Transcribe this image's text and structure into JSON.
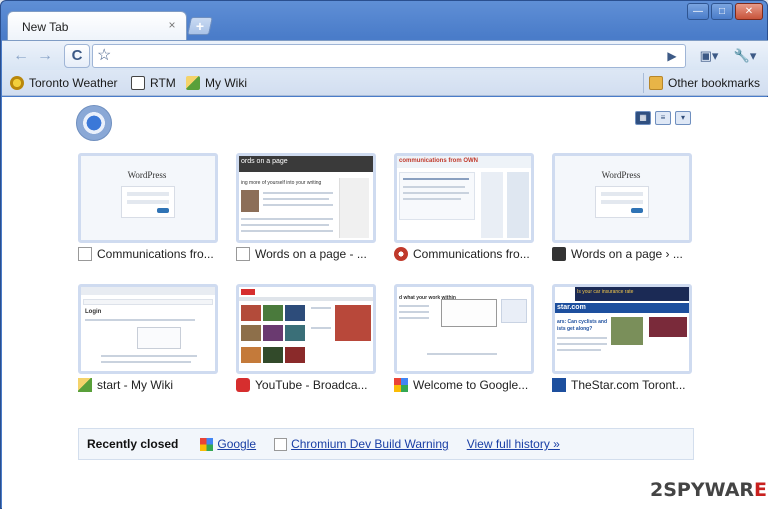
{
  "window": {
    "tab_title": "New Tab",
    "tab_close": "×",
    "new_tab": "+",
    "controls": [
      "—",
      "□",
      "✕"
    ]
  },
  "toolbar": {
    "back_icon": "←",
    "forward_icon": "→",
    "reload_icon": "C",
    "star_icon": "☆",
    "omnibox_value": "",
    "go_icon": "▶",
    "page_icon": "▣▾",
    "wrench_icon": "🔧▾"
  },
  "bookmarks": {
    "items": [
      {
        "label": "Toronto Weather",
        "icon": "weather-icon",
        "color": "#d4a20b"
      },
      {
        "label": "RTM",
        "icon": "rtm-cow-icon",
        "color": "#444444"
      },
      {
        "label": "My Wiki",
        "icon": "wiki-icon",
        "color": "#59a03a"
      }
    ],
    "other": {
      "label": "Other bookmarks",
      "icon": "folder-icon",
      "color": "#e8b447"
    }
  },
  "view_buttons": [
    "▦",
    "≡",
    "▾"
  ],
  "tiles": [
    {
      "title": "Communications fro...",
      "favicon": "page-icon"
    },
    {
      "title": "Words on a page - ...",
      "favicon": "page-icon"
    },
    {
      "title": "Communications fro...",
      "favicon": "owl-icon"
    },
    {
      "title": "Words on a page › ...",
      "favicon": "typewriter-icon"
    },
    {
      "title": "start - My Wiki",
      "favicon": "wiki-icon"
    },
    {
      "title": "YouTube - Broadca...",
      "favicon": "youtube-icon"
    },
    {
      "title": "Welcome to Google...",
      "favicon": "google-icon"
    },
    {
      "title": "TheStar.com Toront...",
      "favicon": "thestar-icon"
    }
  ],
  "thumb_texts": {
    "wordpress": "WordPress",
    "words_header": "ords on a page",
    "words_sub": "ing more of yourself into your writing",
    "comm_header": "communications from OWN",
    "wiki_login": "Login",
    "star_promo": "Is your car insurance rate",
    "star_name": "star.com",
    "star_headline": "ars: Can cyclists and",
    "star_headline2": "ists get along?",
    "google_tag": "d what your work within"
  },
  "recently_closed": {
    "title": "Recently closed",
    "items": [
      {
        "label": "Google",
        "icon": "google-icon"
      },
      {
        "label": "Chromium Dev Build Warning",
        "icon": "page-icon"
      }
    ],
    "history": "View full history »"
  },
  "watermark": {
    "a": "2",
    "b": "SPYWAR",
    "c": "E",
    "sup": "+"
  }
}
